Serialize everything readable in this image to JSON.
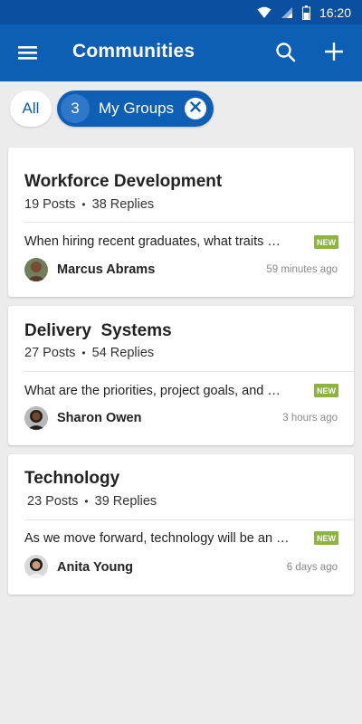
{
  "status_bar": {
    "time": "16:20"
  },
  "app_bar": {
    "title": "Communities"
  },
  "filters": {
    "all_label": "All",
    "group_count": "3",
    "group_label": "My Groups"
  },
  "communities": [
    {
      "name": "Workforce Development",
      "posts": "19 Posts",
      "replies": "38 Replies",
      "question": "When hiring recent graduates, what traits …",
      "badge": "NEW",
      "author": "Marcus Abrams",
      "time": "59 minutes ago"
    },
    {
      "name": "Delivery  Systems",
      "posts": "27 Posts",
      "replies": "54 Replies",
      "question": "What are the priorities, project goals, and …",
      "badge": "NEW",
      "author": "Sharon Owen",
      "time": "3 hours ago"
    },
    {
      "name": "Technology",
      "posts": "23 Posts",
      "replies": "39 Replies",
      "question": "As we move forward, technology will be an …",
      "badge": "NEW",
      "author": "Anita Young",
      "time": "6 days ago"
    }
  ],
  "colors": {
    "app_bar": "#0d5eb5",
    "status_bar": "#0b4fa1",
    "new_badge": "#8db43e"
  }
}
